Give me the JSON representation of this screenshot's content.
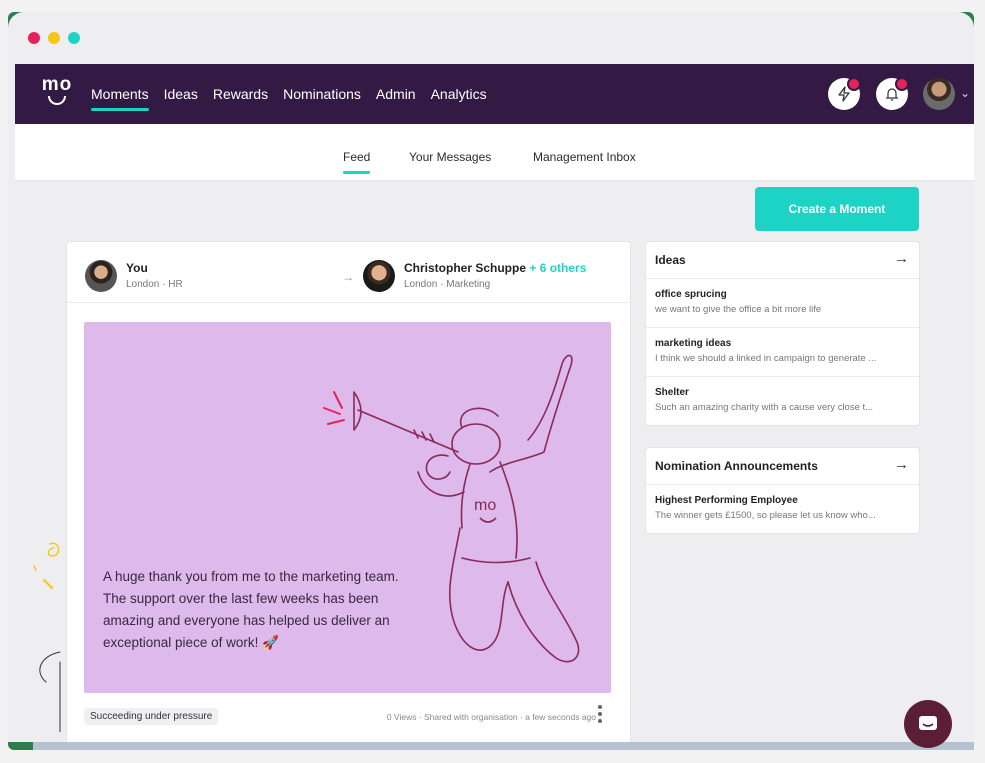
{
  "window": {
    "traffic_colors": [
      "#e6225a",
      "#f5c518",
      "#1dd3c6"
    ]
  },
  "brand": {
    "logo_text": "mo",
    "accent": "#1dd3c6",
    "nav_bg": "#331a45"
  },
  "nav": {
    "links": [
      "Moments",
      "Ideas",
      "Rewards",
      "Nominations",
      "Admin",
      "Analytics"
    ],
    "active": "Moments"
  },
  "subnav": {
    "tabs": [
      "Feed",
      "Your Messages",
      "Management Inbox"
    ],
    "active": "Feed"
  },
  "actions": {
    "create_label": "Create a Moment"
  },
  "post": {
    "from_name": "You",
    "from_meta": "London · HR",
    "to_name": "Christopher Schuppe",
    "to_others": "+ 6 others",
    "to_meta": "London · Marketing",
    "card_text": "A huge thank you from me to the marketing team. The support over the last few weeks has been amazing and everyone has helped us deliver an exceptional piece of work! 🚀",
    "card_color": "#ddb9ec",
    "tag": "Succeeding under pressure",
    "meta": "0 Views · Shared with organisation · a few seconds ago"
  },
  "ideas_panel": {
    "title": "Ideas",
    "items": [
      {
        "title": "office sprucing",
        "desc": "we want to give the office a bit more life"
      },
      {
        "title": "marketing ideas",
        "desc": "I think we should a linked in campaign to generate ..."
      },
      {
        "title": "Shelter",
        "desc": "Such an amazing charity with a cause very close t..."
      }
    ]
  },
  "nominations_panel": {
    "title": "Nomination Announcements",
    "items": [
      {
        "title": "Highest Performing Employee",
        "desc": "The winner gets £1500, so please let us know who..."
      }
    ]
  }
}
